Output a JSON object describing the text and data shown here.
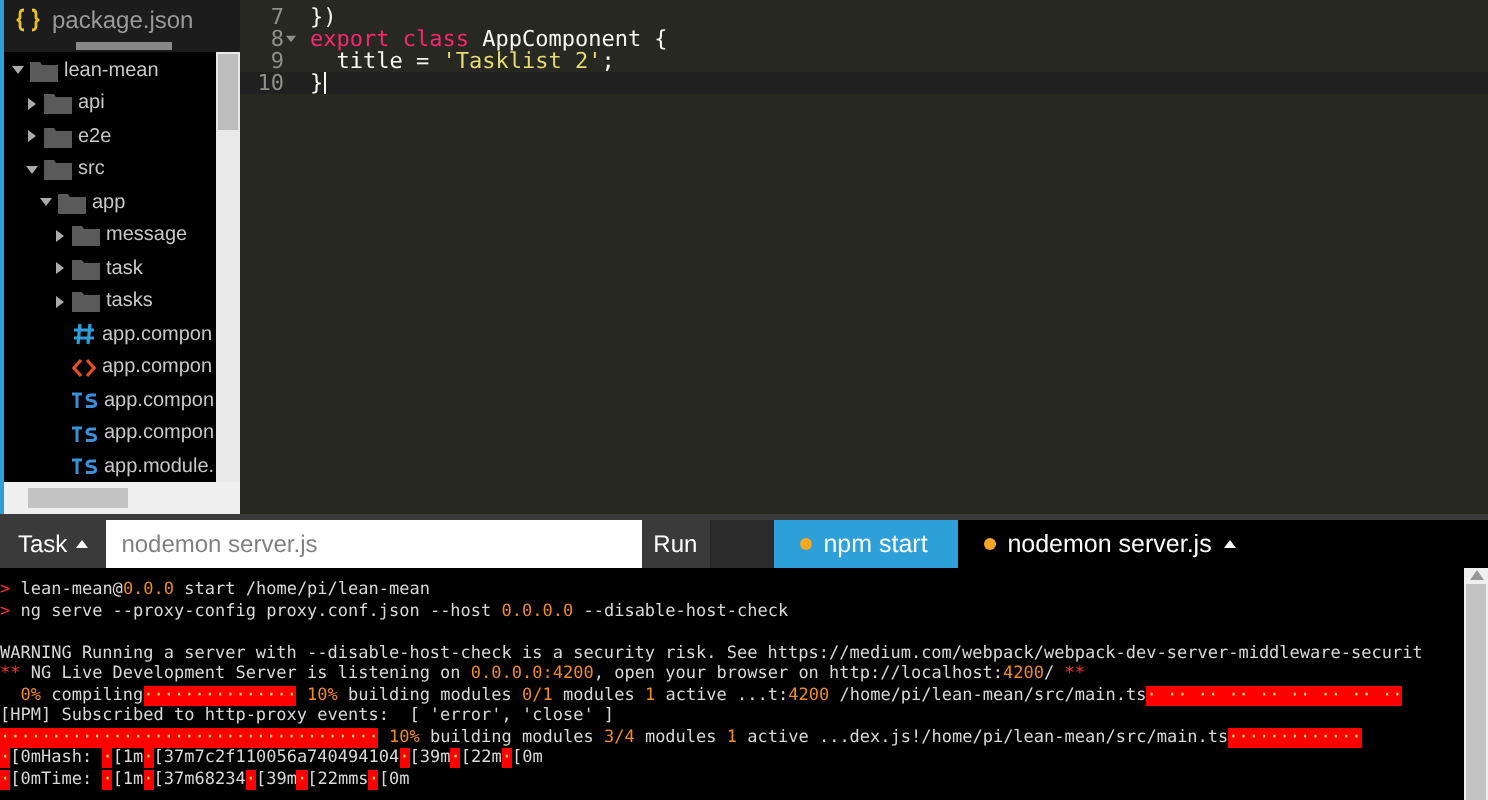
{
  "file_list_top": {
    "name": "package.json",
    "kind": "json"
  },
  "tree": [
    {
      "name": "lean-mean",
      "kind": "folder",
      "expanded": true,
      "children": [
        {
          "name": "api",
          "kind": "folder",
          "expanded": false
        },
        {
          "name": "e2e",
          "kind": "folder",
          "expanded": false
        },
        {
          "name": "src",
          "kind": "folder",
          "expanded": true,
          "children": [
            {
              "name": "app",
              "kind": "folder",
              "expanded": true,
              "children": [
                {
                  "name": "message",
                  "kind": "folder",
                  "expanded": false
                },
                {
                  "name": "task",
                  "kind": "folder",
                  "expanded": false
                },
                {
                  "name": "tasks",
                  "kind": "folder",
                  "expanded": false
                },
                {
                  "name": "app.compon",
                  "kind": "css"
                },
                {
                  "name": "app.compon",
                  "kind": "html"
                },
                {
                  "name": "app.compon",
                  "kind": "ts"
                },
                {
                  "name": "app.compon",
                  "kind": "ts"
                },
                {
                  "name": "app.module.",
                  "kind": "ts"
                }
              ]
            }
          ]
        }
      ]
    }
  ],
  "editor": {
    "lines": [
      {
        "number": "7",
        "fold": false,
        "active": false,
        "tokens": [
          {
            "text": "})",
            "kind": "plain"
          }
        ]
      },
      {
        "number": "8",
        "fold": true,
        "active": false,
        "tokens": [
          {
            "text": "export class ",
            "kind": "keyword"
          },
          {
            "text": "AppComponent {",
            "kind": "plain"
          }
        ]
      },
      {
        "number": "9",
        "fold": false,
        "active": false,
        "tokens": [
          {
            "text": "  title = ",
            "kind": "plain"
          },
          {
            "text": "'Tasklist 2'",
            "kind": "string"
          },
          {
            "text": ";",
            "kind": "plain"
          }
        ]
      },
      {
        "number": "10",
        "fold": false,
        "active": true,
        "tokens": [
          {
            "text": "}",
            "kind": "plain"
          }
        ]
      }
    ]
  },
  "task_bar": {
    "menu": "Task",
    "placeholder": "nodemon server.js",
    "run": "Run",
    "tabs": [
      {
        "label": "npm start",
        "selected": true
      },
      {
        "label": "nodemon server.js",
        "selected": false
      }
    ]
  },
  "terminal": {
    "lines": [
      {
        "gap_before": false,
        "segments": [
          {
            "text": "> ",
            "kind": "prompt"
          },
          {
            "text": "lean-mean@",
            "kind": "plain"
          },
          {
            "text": "0.0.0",
            "kind": "num"
          },
          {
            "text": " start /home/pi/lean-mean",
            "kind": "plain"
          }
        ]
      },
      {
        "gap_before": false,
        "segments": [
          {
            "text": "> ",
            "kind": "prompt"
          },
          {
            "text": "ng serve --proxy-config proxy.conf.json --host ",
            "kind": "plain"
          },
          {
            "text": "0.0.0.0",
            "kind": "num"
          },
          {
            "text": " --disable-host-check",
            "kind": "plain"
          }
        ]
      },
      {
        "gap_before": true,
        "segments": [
          {
            "text": "WARNING Running a server with --disable-host-check is a security risk. See https://medium.com/webpack/webpack-dev-server-middleware-securit",
            "kind": "plain"
          }
        ]
      },
      {
        "gap_before": false,
        "segments": [
          {
            "text": "** ",
            "kind": "prompt"
          },
          {
            "text": "NG Live Development Server is listening on ",
            "kind": "plain"
          },
          {
            "text": "0.0.0.0:4200",
            "kind": "num"
          },
          {
            "text": ", open your browser on http://localhost:",
            "kind": "plain"
          },
          {
            "text": "4200",
            "kind": "num"
          },
          {
            "text": "/ ",
            "kind": "plain"
          },
          {
            "text": "**",
            "kind": "prompt"
          }
        ]
      },
      {
        "gap_before": false,
        "segments": [
          {
            "text": "  0%",
            "kind": "num"
          },
          {
            "text": " compiling",
            "kind": "plain"
          },
          {
            "text": "···············",
            "kind": "block"
          },
          {
            "text": " 10%",
            "kind": "num"
          },
          {
            "text": " building modules ",
            "kind": "plain"
          },
          {
            "text": "0/1",
            "kind": "num"
          },
          {
            "text": " modules ",
            "kind": "plain"
          },
          {
            "text": "1",
            "kind": "num"
          },
          {
            "text": " active ...t:",
            "kind": "plain"
          },
          {
            "text": "4200",
            "kind": "num"
          },
          {
            "text": " /home/pi/lean-mean/src/main.ts",
            "kind": "plain"
          },
          {
            "text": "· ·· ·· ·· ·· ·· ·· ·· ··",
            "kind": "block"
          }
        ]
      },
      {
        "gap_before": false,
        "segments": [
          {
            "text": "[HPM] Subscribed to http-proxy events:  [ 'error', 'close' ]",
            "kind": "plain"
          }
        ]
      },
      {
        "gap_before": false,
        "segments": [
          {
            "text": "·····································",
            "kind": "block"
          },
          {
            "text": " 10%",
            "kind": "num"
          },
          {
            "text": " building modules ",
            "kind": "plain"
          },
          {
            "text": "3/4",
            "kind": "num"
          },
          {
            "text": " modules ",
            "kind": "plain"
          },
          {
            "text": "1",
            "kind": "num"
          },
          {
            "text": " active ...dex.js!/home/pi/lean-mean/src/main.ts",
            "kind": "plain"
          },
          {
            "text": "·············",
            "kind": "block"
          }
        ]
      },
      {
        "gap_before": false,
        "segments": [
          {
            "text": "·",
            "kind": "block"
          },
          {
            "text": "[0mHash: ",
            "kind": "plain"
          },
          {
            "text": "·",
            "kind": "block"
          },
          {
            "text": "[1m",
            "kind": "plain"
          },
          {
            "text": "·",
            "kind": "block"
          },
          {
            "text": "[37m7c2f110056a740494104",
            "kind": "plain"
          },
          {
            "text": "·",
            "kind": "block"
          },
          {
            "text": "[39m",
            "kind": "plain"
          },
          {
            "text": "·",
            "kind": "block"
          },
          {
            "text": "[22m",
            "kind": "plain"
          },
          {
            "text": "·",
            "kind": "block"
          },
          {
            "text": "[0m",
            "kind": "plain"
          }
        ]
      },
      {
        "gap_before": false,
        "segments": [
          {
            "text": "·",
            "kind": "block"
          },
          {
            "text": "[0mTime: ",
            "kind": "plain"
          },
          {
            "text": "·",
            "kind": "block"
          },
          {
            "text": "[1m",
            "kind": "plain"
          },
          {
            "text": "·",
            "kind": "block"
          },
          {
            "text": "[37m68234",
            "kind": "plain"
          },
          {
            "text": "·",
            "kind": "block"
          },
          {
            "text": "[39m",
            "kind": "plain"
          },
          {
            "text": "·",
            "kind": "block"
          },
          {
            "text": "[22mms",
            "kind": "plain"
          },
          {
            "text": "·",
            "kind": "block"
          },
          {
            "text": "[0m",
            "kind": "plain"
          }
        ]
      }
    ]
  }
}
